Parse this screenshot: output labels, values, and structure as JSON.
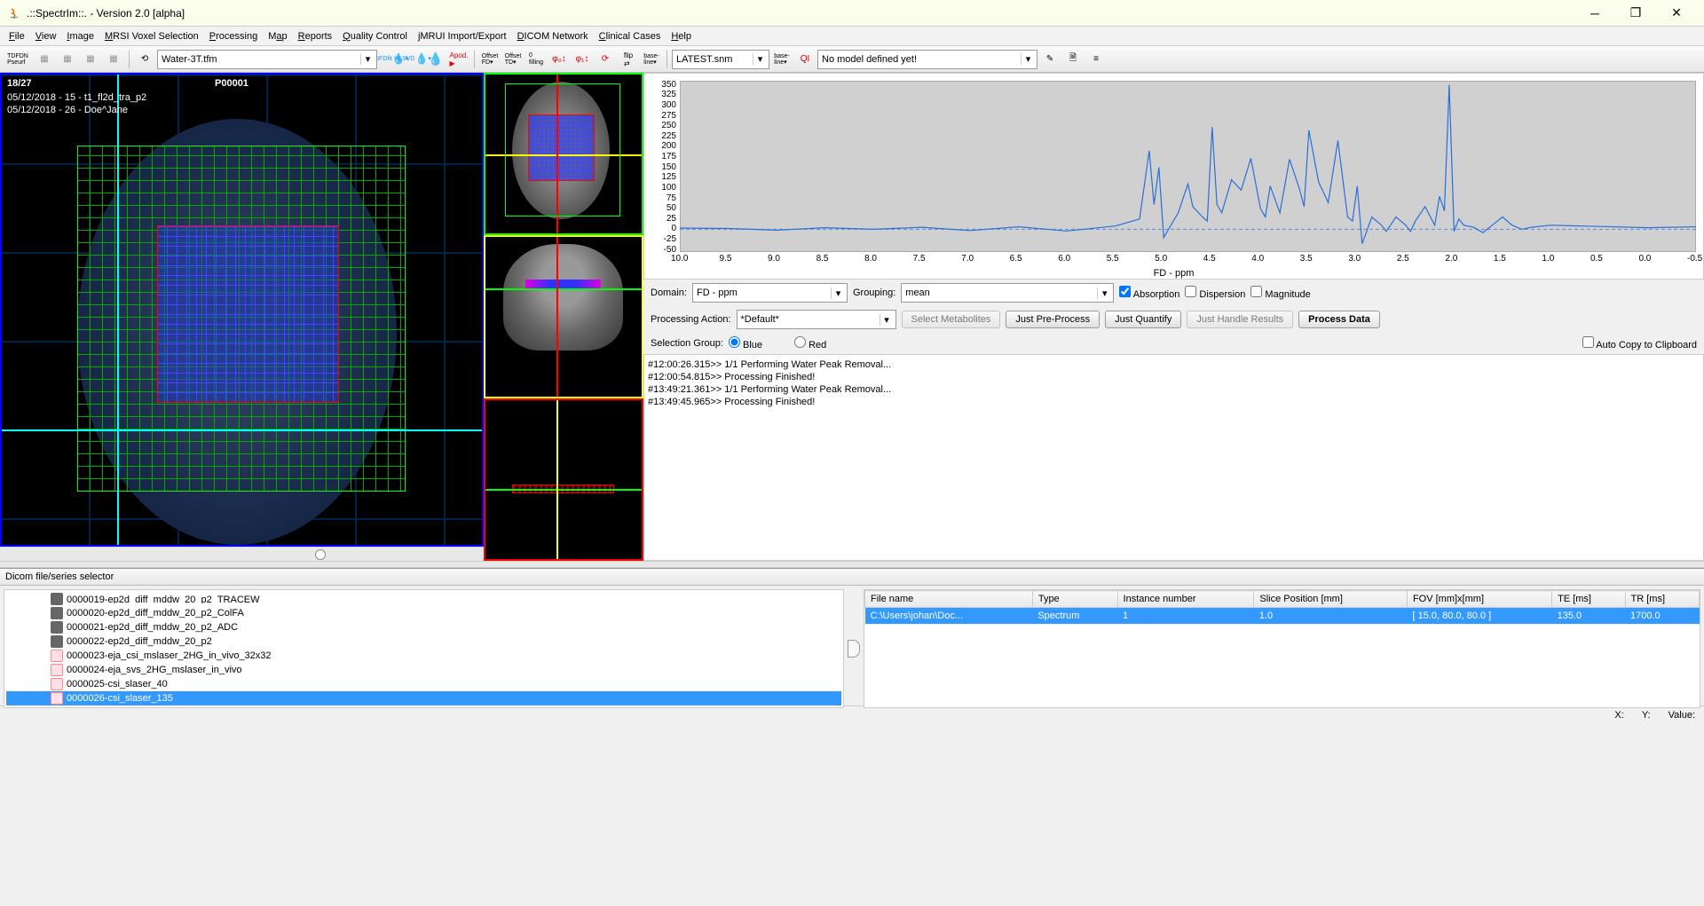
{
  "window": {
    "title": ".::SpectrIm::.   -   Version 2.0 [alpha]"
  },
  "menu": [
    "File",
    "View",
    "Image",
    "MRSI Voxel Selection",
    "Processing",
    "Map",
    "Reports",
    "Quality Control",
    "jMRUI Import/Export",
    "DICOM Network",
    "Clinical Cases",
    "Help"
  ],
  "toolbar": {
    "water_combo": "Water-3T.tfm",
    "latest_combo": "LATEST.snm",
    "model_combo": "No model defined yet!"
  },
  "viewer": {
    "slice": "18/27",
    "patient": "P00001",
    "line1": "05/12/2018 - 15 - t1_fl2d_tra_p2",
    "line2": "05/12/2018 - 26 - Doe^Jane"
  },
  "controls": {
    "domain_label": "Domain:",
    "domain_value": "FD - ppm",
    "grouping_label": "Grouping:",
    "grouping_value": "mean",
    "absorption": "Absorption",
    "dispersion": "Dispersion",
    "magnitude": "Magnitude",
    "proc_action_label": "Processing Action:",
    "proc_action_value": "*Default*",
    "select_metab": "Select Metabolites",
    "just_pre": "Just Pre-Process",
    "just_quant": "Just Quantify",
    "just_handle": "Just Handle Results",
    "process": "Process Data",
    "sel_group_label": "Selection Group:",
    "blue": "Blue",
    "red": "Red",
    "autocopy": "Auto Copy to Clipboard"
  },
  "log": [
    "#12:00:26.315>> 1/1 Performing Water Peak Removal...",
    "#12:00:54.815>> Processing Finished!",
    "#13:49:21.361>> 1/1 Performing Water Peak Removal...",
    "#13:49:45.965>> Processing Finished!"
  ],
  "bottom": {
    "header": "Dicom file/series selector",
    "tree": [
      {
        "icon": "gray",
        "label": "0000019-ep2d_diff_mddw_20_p2_TRACEW",
        "sel": false,
        "cut": true
      },
      {
        "icon": "gray",
        "label": "0000020-ep2d_diff_mddw_20_p2_ColFA",
        "sel": false
      },
      {
        "icon": "gray",
        "label": "0000021-ep2d_diff_mddw_20_p2_ADC",
        "sel": false
      },
      {
        "icon": "gray",
        "label": "0000022-ep2d_diff_mddw_20_p2",
        "sel": false
      },
      {
        "icon": "pink",
        "label": "0000023-eja_csi_mslaser_2HG_in_vivo_32x32",
        "sel": false
      },
      {
        "icon": "pink",
        "label": "0000024-eja_svs_2HG_mslaser_in_vivo",
        "sel": false
      },
      {
        "icon": "pink",
        "label": "0000025-csi_slaser_40",
        "sel": false
      },
      {
        "icon": "pink",
        "label": "0000026-csi_slaser_135",
        "sel": true
      }
    ],
    "table_headers": [
      "File name",
      "Type",
      "Instance number",
      "Slice Position [mm]",
      "FOV [mm]x[mm]",
      "TE [ms]",
      "TR [ms]"
    ],
    "table_row": [
      "C:\\Users\\johan\\Doc...",
      "Spectrum",
      "1",
      "1.0",
      "[ 15.0, 80.0, 80.0 ]",
      "135.0",
      "1700.0"
    ]
  },
  "chart_data": {
    "type": "line",
    "title": "",
    "xlabel": "FD - ppm",
    "ylabel": "",
    "xlim": [
      10.0,
      -0.5
    ],
    "ylim": [
      -55,
      360
    ],
    "yticks": [
      -50,
      -25,
      0,
      25,
      50,
      75,
      100,
      125,
      150,
      175,
      200,
      225,
      250,
      275,
      300,
      325,
      350
    ],
    "xticks": [
      10.0,
      9.5,
      9.0,
      8.5,
      8.0,
      7.5,
      7.0,
      6.5,
      6.0,
      5.5,
      5.0,
      4.5,
      4.0,
      3.5,
      3.0,
      2.5,
      2.0,
      1.5,
      1.0,
      0.5,
      0.0,
      -0.5
    ],
    "series": [
      {
        "name": "spectrum",
        "color": "#2a6fd6",
        "x": [
          10.0,
          9.5,
          9.0,
          8.5,
          8.0,
          7.5,
          7.0,
          6.5,
          6.0,
          5.5,
          5.25,
          5.15,
          5.1,
          5.05,
          5.0,
          4.85,
          4.75,
          4.7,
          4.6,
          4.55,
          4.5,
          4.45,
          4.4,
          4.3,
          4.2,
          4.1,
          4.0,
          3.95,
          3.9,
          3.8,
          3.7,
          3.6,
          3.55,
          3.5,
          3.4,
          3.3,
          3.2,
          3.1,
          3.05,
          3.0,
          2.95,
          2.85,
          2.75,
          2.7,
          2.6,
          2.5,
          2.45,
          2.4,
          2.3,
          2.2,
          2.15,
          2.1,
          2.05,
          2.0,
          1.95,
          1.9,
          1.8,
          1.7,
          1.5,
          1.4,
          1.3,
          1.2,
          1.0,
          0.5,
          0.0,
          -0.5
        ],
        "y": [
          3,
          2,
          -2,
          4,
          0,
          5,
          -3,
          6,
          -4,
          8,
          25,
          190,
          60,
          150,
          -20,
          40,
          110,
          55,
          30,
          20,
          248,
          60,
          40,
          120,
          95,
          172,
          50,
          30,
          105,
          40,
          170,
          100,
          55,
          240,
          115,
          65,
          215,
          30,
          20,
          105,
          -35,
          30,
          10,
          -5,
          30,
          10,
          -5,
          20,
          55,
          10,
          80,
          45,
          350,
          -5,
          25,
          10,
          5,
          -8,
          30,
          10,
          0,
          5,
          10,
          7,
          4,
          6
        ]
      }
    ]
  },
  "status": {
    "x": "X:",
    "y": "Y:",
    "value": "Value:"
  }
}
